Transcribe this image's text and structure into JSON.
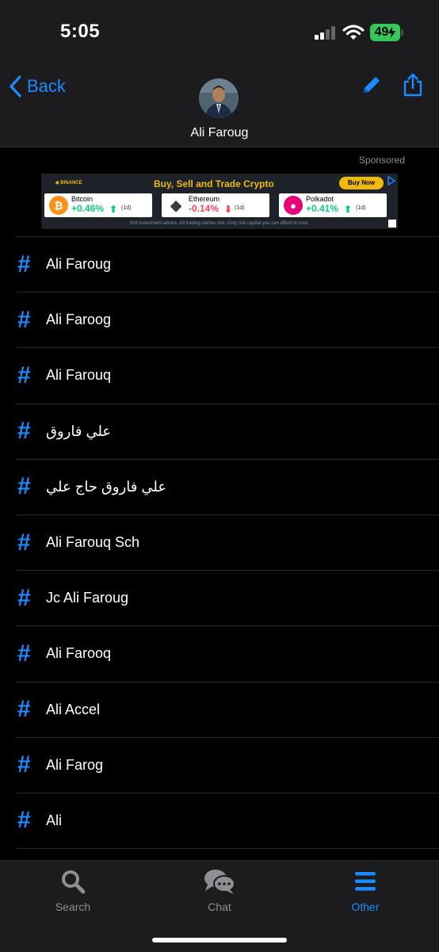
{
  "status_bar": {
    "time": "5:05",
    "battery": "49"
  },
  "nav": {
    "back_label": "Back",
    "title": "Ali Faroug"
  },
  "ad": {
    "sponsored_label": "Sponsored",
    "brand": "BINANCE",
    "headline": "Buy, Sell and Trade Crypto",
    "cta": "Buy Now",
    "coins": [
      {
        "name": "Bitcoin",
        "change": "+0.46%",
        "period": "(1d)",
        "direction": "up",
        "color": "#f7931a",
        "symbol": "₿"
      },
      {
        "name": "Ethereum",
        "change": "-0.14%",
        "period": "(1d)",
        "direction": "down",
        "color": "#3c3c3d",
        "symbol": "◆"
      },
      {
        "name": "Polkadot",
        "change": "+0.41%",
        "period": "(1d)",
        "direction": "up",
        "color": "#e6007a",
        "symbol": "●"
      }
    ],
    "disclaimer": "Not investment advice. All trading carries risk. Only risk capital you can afford to lose."
  },
  "tags": [
    {
      "label": "Ali Faroug"
    },
    {
      "label": "Ali Faroog"
    },
    {
      "label": "Ali Farouq"
    },
    {
      "label": "علي فاروق"
    },
    {
      "label": "علي فاروق حاج علي"
    },
    {
      "label": "Ali Farouq Sch"
    },
    {
      "label": "Jc Ali Faroug"
    },
    {
      "label": "Ali Farooq"
    },
    {
      "label": "Ali Accel"
    },
    {
      "label": "Ali Farog"
    },
    {
      "label": "Ali"
    }
  ],
  "tabbar": {
    "search": "Search",
    "chat": "Chat",
    "other": "Other",
    "active": "other"
  },
  "colors": {
    "accent": "#1a8cff",
    "up": "#0ecb81",
    "down": "#f6465d",
    "battery": "#34c759"
  }
}
